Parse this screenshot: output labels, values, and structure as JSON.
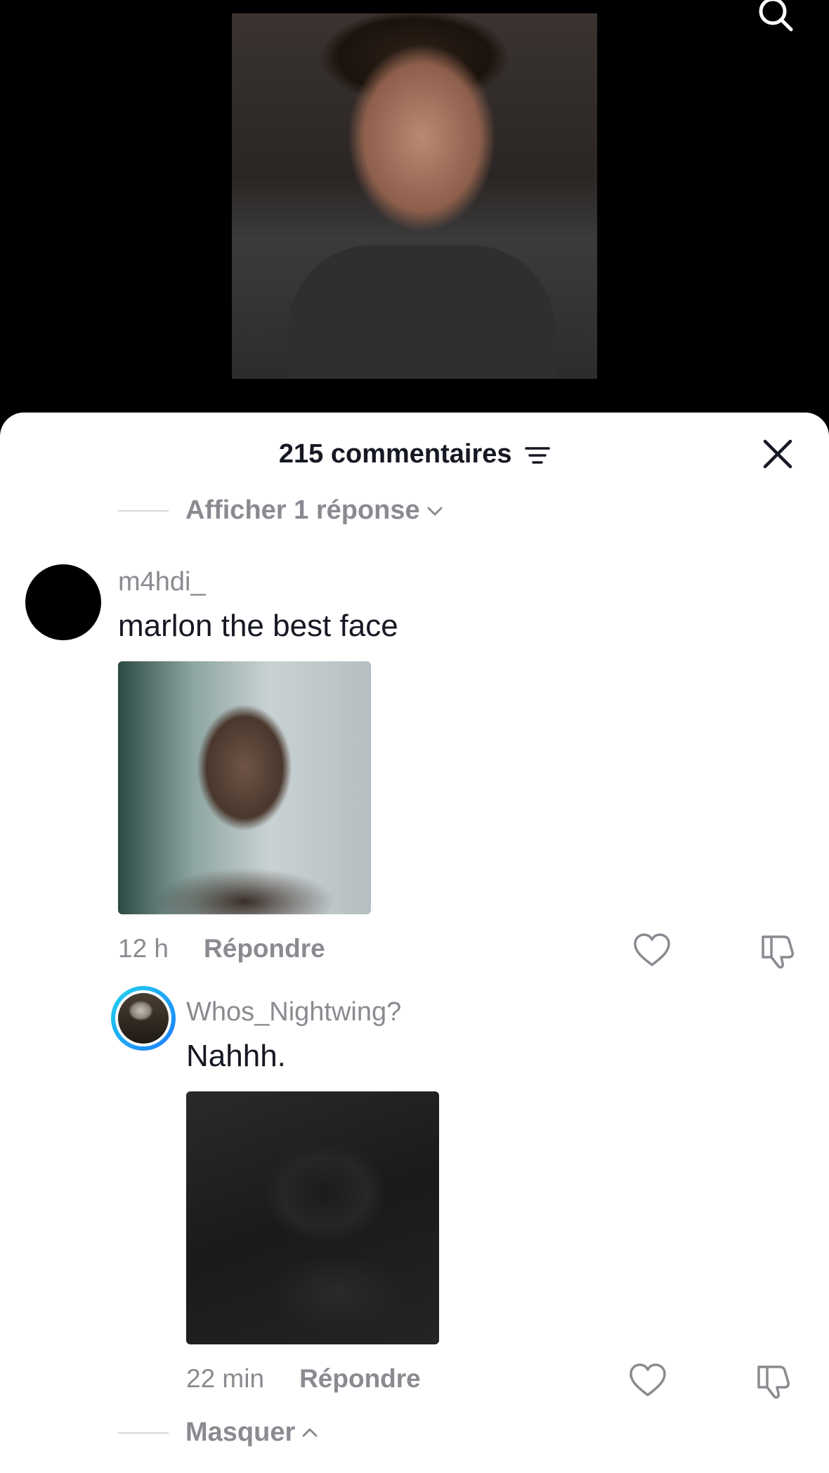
{
  "colors": {
    "sheet_background": "#ffffff",
    "primary_text": "#161823",
    "secondary_text": "#8a8b91",
    "reply_ring_start": "#20d5ec",
    "reply_ring_end": "#1e7bff"
  },
  "header": {
    "comment_count": "215 commentaires",
    "filter_icon": "filter-lines-icon",
    "close_icon": "close-icon"
  },
  "top_toggle": {
    "label": "Afficher 1 réponse"
  },
  "comments": [
    {
      "username": "m4hdi_",
      "text": "marlon the best face",
      "time": "12 h",
      "reply_label": "Répondre"
    }
  ],
  "replies": [
    {
      "username": "Whos_Nightwing?",
      "text": "Nahhh.",
      "time": "22 min",
      "reply_label": "Répondre"
    }
  ],
  "bottom_toggle": {
    "label": "Masquer"
  }
}
